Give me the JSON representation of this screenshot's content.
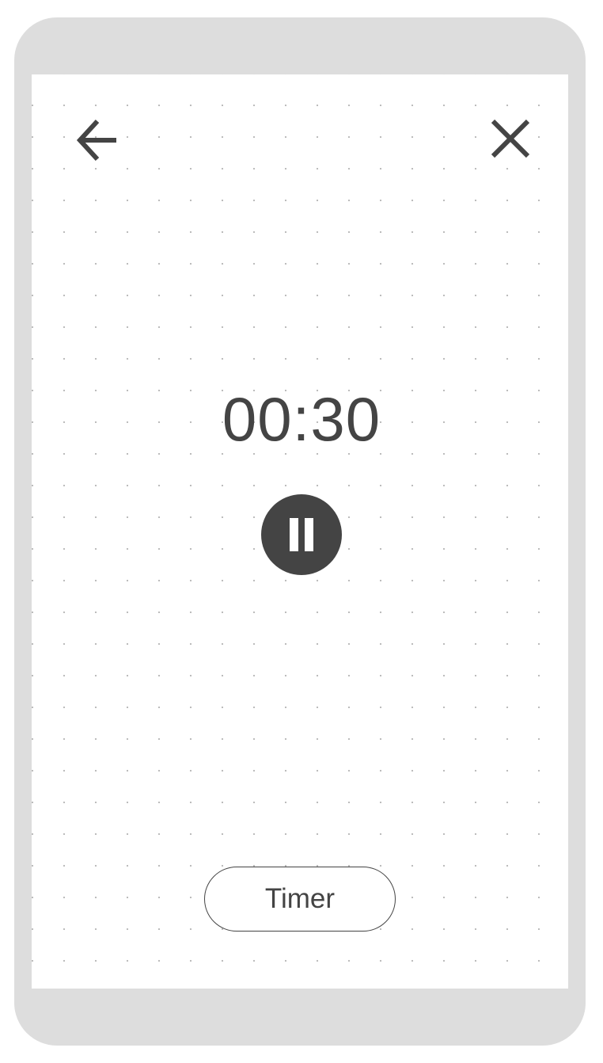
{
  "timer": {
    "display": "00:30",
    "state": "running"
  },
  "controls": {
    "back_icon": "arrow-left-icon",
    "close_icon": "close-icon",
    "pause_icon": "pause-icon",
    "timer_button_label": "Timer"
  },
  "colors": {
    "frame": "#dddddd",
    "foreground": "#444444",
    "screen": "#ffffff",
    "dot_grid": "#b9b9b9"
  }
}
